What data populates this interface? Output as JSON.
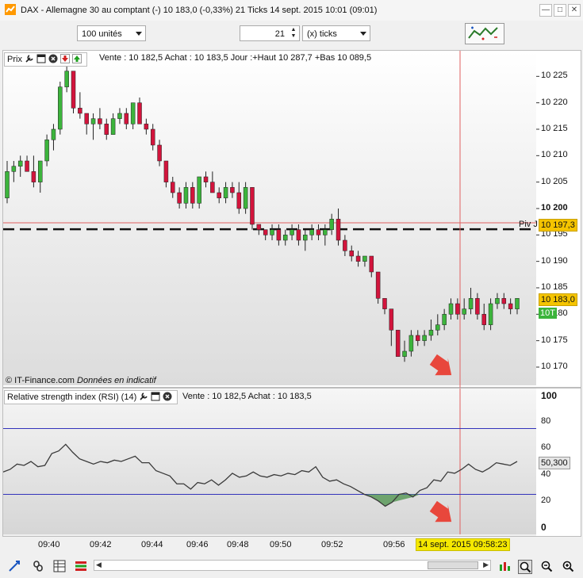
{
  "window": {
    "title": "DAX - Allemagne 30 au comptant (-)    10 183,0 (-0,33%)    21 Ticks  14 sept. 2015 10:01 (09:01)",
    "controls": [
      "—",
      "□",
      "✕"
    ]
  },
  "toolbar": {
    "units_value": "100 unités",
    "ticks_count": "21",
    "ticks_mode": "(x) ticks"
  },
  "price_panel": {
    "label": "Prix",
    "quote": "Vente : 10 182,5 Achat : 10 183,5 Jour :+Haut 10 287,7 +Bas 10 089,5",
    "watermark": "© IT-Finance.com",
    "watermark_note": "Données en indicatif",
    "y_ticks": [
      "10 225",
      "10 220",
      "10 215",
      "10 210",
      "10 205",
      "10 200",
      "10 195",
      "10 190",
      "10 185",
      "10 180",
      "10 175",
      "10 170"
    ],
    "pivot_label": "Piv J",
    "pivot_value": "10 197,3",
    "last_price": "10 183,0",
    "tag_10t": "10T"
  },
  "rsi_panel": {
    "label": "Relative strength index (RSI) (14)",
    "quote": "Vente : 10 182,5 Achat : 10 183,5",
    "y_ticks": [
      "100",
      "80",
      "60",
      "40",
      "20",
      "0"
    ],
    "current_value": "50,300"
  },
  "x_axis": {
    "ticks": [
      "09:40",
      "09:42",
      "09:44",
      "09:46",
      "09:48",
      "09:50",
      "09:52",
      "09:56"
    ],
    "cursor_label": "14 sept. 2015 09:58:23"
  },
  "colors": {
    "bull": "#3cb43c",
    "bear": "#d2143c",
    "rsi_line": "#3a3a3a",
    "rsi_band": "#3333bb",
    "cursor": "#e06060",
    "arrow": "#e8473c",
    "last_price_bg": "#f5c400"
  },
  "chart_data": [
    {
      "type": "candlestick",
      "title": "",
      "ylim": [
        10167,
        10230
      ],
      "candles": [
        [
          10202,
          10209,
          10201,
          10207
        ],
        [
          10207,
          10209,
          10205,
          10208
        ],
        [
          10208,
          10210,
          10206,
          10209
        ],
        [
          10209,
          10210,
          10207,
          10207
        ],
        [
          10207,
          10210,
          10204,
          10205
        ],
        [
          10205,
          10209,
          10203,
          10209
        ],
        [
          10209,
          10214,
          10208,
          10213
        ],
        [
          10213,
          10216,
          10211,
          10215
        ],
        [
          10215,
          10224,
          10214,
          10223
        ],
        [
          10223,
          10228,
          10222,
          10226
        ],
        [
          10226,
          10226,
          10218,
          10219
        ],
        [
          10219,
          10222,
          10217,
          10218
        ],
        [
          10218,
          10218,
          10214,
          10216
        ],
        [
          10216,
          10218,
          10213,
          10217
        ],
        [
          10217,
          10219,
          10215,
          10216
        ],
        [
          10216,
          10217,
          10213,
          10214
        ],
        [
          10214,
          10218,
          10214,
          10217
        ],
        [
          10217,
          10219,
          10216,
          10218
        ],
        [
          10218,
          10219,
          10215,
          10216
        ],
        [
          10216,
          10220,
          10215,
          10220
        ],
        [
          10220,
          10221,
          10216,
          10216
        ],
        [
          10216,
          10217,
          10214,
          10215
        ],
        [
          10215,
          10216,
          10211,
          10212
        ],
        [
          10212,
          10213,
          10208,
          10209
        ],
        [
          10209,
          10209,
          10204,
          10205
        ],
        [
          10205,
          10206,
          10202,
          10203
        ],
        [
          10203,
          10204,
          10200,
          10201
        ],
        [
          10201,
          10205,
          10200,
          10204
        ],
        [
          10204,
          10205,
          10200,
          10201
        ],
        [
          10201,
          10206,
          10200,
          10206
        ],
        [
          10206,
          10207,
          10204,
          10205
        ],
        [
          10205,
          10207,
          10203,
          10203
        ],
        [
          10203,
          10204,
          10201,
          10202
        ],
        [
          10202,
          10205,
          10201,
          10204
        ],
        [
          10204,
          10205,
          10202,
          10203
        ],
        [
          10203,
          10205,
          10199,
          10200
        ],
        [
          10200,
          10205,
          10199,
          10204
        ],
        [
          10204,
          10204,
          10196,
          10197
        ],
        [
          10197,
          10197,
          10195,
          10196
        ],
        [
          10196,
          10196,
          10194,
          10195
        ],
        [
          10195,
          10197,
          10194,
          10196
        ],
        [
          10196,
          10197,
          10193,
          10194
        ],
        [
          10194,
          10196,
          10193,
          10195
        ],
        [
          10195,
          10197,
          10194,
          10196
        ],
        [
          10196,
          10197,
          10193,
          10194
        ],
        [
          10194,
          10196,
          10192,
          10195
        ],
        [
          10195,
          10197,
          10194,
          10196
        ],
        [
          10196,
          10197,
          10194,
          10195
        ],
        [
          10195,
          10197,
          10193,
          10196
        ],
        [
          10196,
          10199,
          10195,
          10198
        ],
        [
          10198,
          10200,
          10193,
          10194
        ],
        [
          10194,
          10195,
          10191,
          10192
        ],
        [
          10192,
          10193,
          10190,
          10191
        ],
        [
          10191,
          10192,
          10189,
          10190
        ],
        [
          10190,
          10191,
          10189,
          10191
        ],
        [
          10191,
          10191,
          10187,
          10188
        ],
        [
          10188,
          10188,
          10182,
          10183
        ],
        [
          10183,
          10183,
          10180,
          10181
        ],
        [
          10181,
          10181,
          10174,
          10177
        ],
        [
          10177,
          10177,
          10172,
          10172
        ],
        [
          10172,
          10175,
          10171,
          10173
        ],
        [
          10173,
          10177,
          10172,
          10176
        ],
        [
          10176,
          10177,
          10174,
          10175
        ],
        [
          10175,
          10177,
          10174,
          10176
        ],
        [
          10176,
          10179,
          10175,
          10177
        ],
        [
          10177,
          10180,
          10176,
          10178
        ],
        [
          10178,
          10181,
          10177,
          10180
        ],
        [
          10180,
          10183,
          10179,
          10182
        ],
        [
          10182,
          10183,
          10179,
          10180
        ],
        [
          10180,
          10183,
          10179,
          10181
        ],
        [
          10181,
          10185,
          10180,
          10183
        ],
        [
          10183,
          10184,
          10179,
          10180
        ],
        [
          10180,
          10182,
          10177,
          10178
        ],
        [
          10178,
          10183,
          10177,
          10182
        ],
        [
          10182,
          10184,
          10181,
          10183
        ],
        [
          10183,
          10184,
          10181,
          10182
        ],
        [
          10182,
          10183,
          10180,
          10181
        ],
        [
          10181,
          10183,
          10180,
          10183
        ]
      ],
      "pivot_level": 10197.3,
      "support_level": 10196
    },
    {
      "type": "line",
      "title": "",
      "ylim": [
        0,
        100
      ],
      "band_lines": [
        75,
        25
      ],
      "values": [
        42,
        44,
        48,
        47,
        50,
        46,
        47,
        56,
        58,
        63,
        57,
        52,
        50,
        48,
        50,
        49,
        51,
        50,
        52,
        54,
        49,
        49,
        43,
        41,
        39,
        33,
        33,
        29,
        34,
        33,
        36,
        32,
        36,
        41,
        38,
        39,
        42,
        39,
        38,
        40,
        39,
        41,
        40,
        43,
        42,
        46,
        38,
        35,
        36,
        33,
        31,
        28,
        25,
        23,
        20,
        16,
        19,
        25,
        26,
        23,
        28,
        30,
        36,
        35,
        42,
        41,
        44,
        48,
        44,
        42,
        45,
        49,
        48,
        47,
        50
      ]
    }
  ]
}
